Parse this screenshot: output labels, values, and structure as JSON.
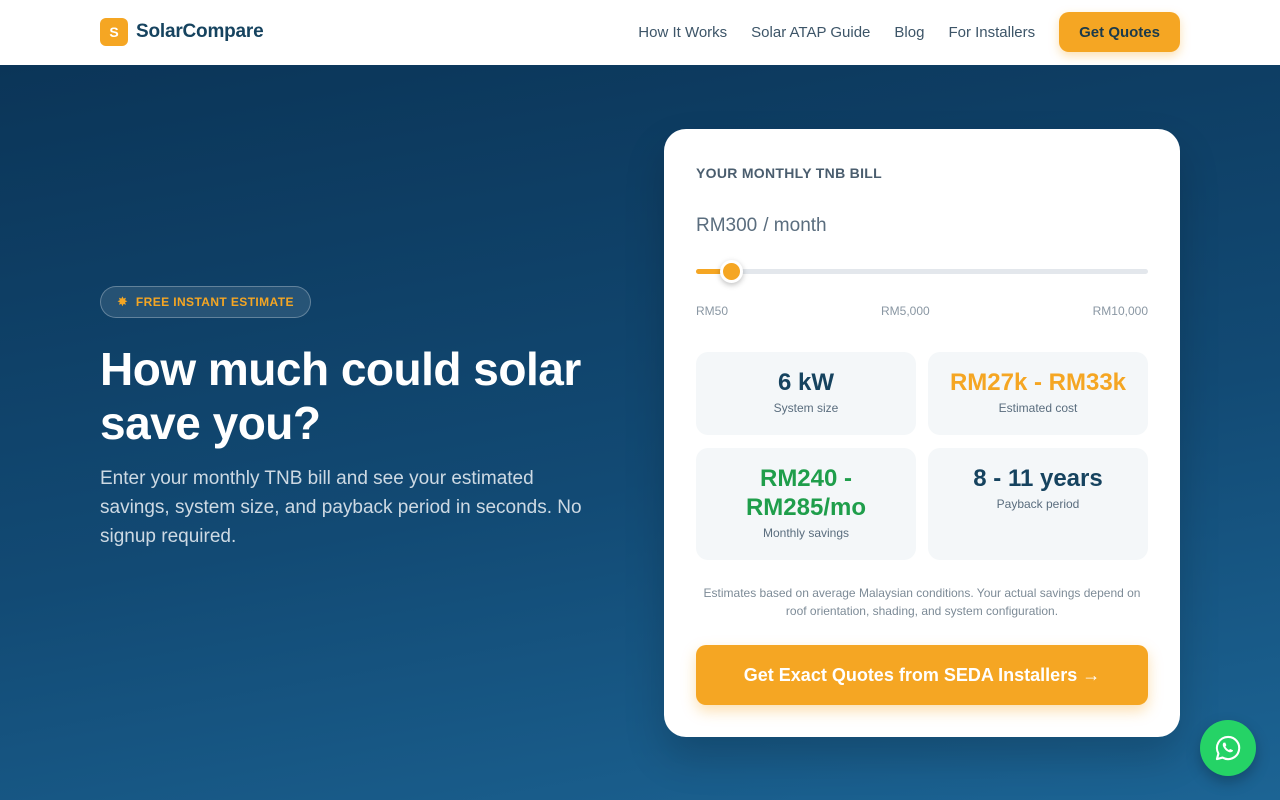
{
  "nav": {
    "logo_letter": "S",
    "brand": "SolarCompare",
    "links": [
      "How It Works",
      "Solar ATAP Guide",
      "Blog",
      "For Installers"
    ],
    "cta": "Get Quotes"
  },
  "hero": {
    "badge_icon": "sun-icon",
    "badge": "FREE INSTANT ESTIMATE",
    "title": "How much could solar save you?",
    "subtitle": "Enter your monthly TNB bill and see your estimated savings, system size, and payback period in seconds. No signup required."
  },
  "calculator": {
    "label": "YOUR MONTHLY TNB BILL",
    "amount": "RM300",
    "unit": "/ month",
    "slider": {
      "min": 50,
      "max": 10000,
      "value": 300
    },
    "ticks": {
      "min": "RM50",
      "mid": "RM5,000",
      "max": "RM10,000"
    },
    "stats": {
      "system_size": {
        "value": "6 kW",
        "label": "System size"
      },
      "cost": {
        "value": "RM27k - RM33k",
        "label": "Estimated cost"
      },
      "savings": {
        "value": "RM240 - RM285/mo",
        "label": "Monthly savings"
      },
      "payback": {
        "value": "8 - 11 years",
        "label": "Payback period"
      }
    },
    "disclaimer": "Estimates based on average Malaysian conditions. Your actual savings depend on roof orientation, shading, and system configuration.",
    "cta": "Get Exact Quotes from SEDA Installers →"
  },
  "whatsapp": {
    "icon": "whatsapp-icon"
  },
  "colors": {
    "accent": "#f5a623",
    "navy": "#16435f",
    "green": "#1f9e4b",
    "whatsapp": "#25d366"
  }
}
